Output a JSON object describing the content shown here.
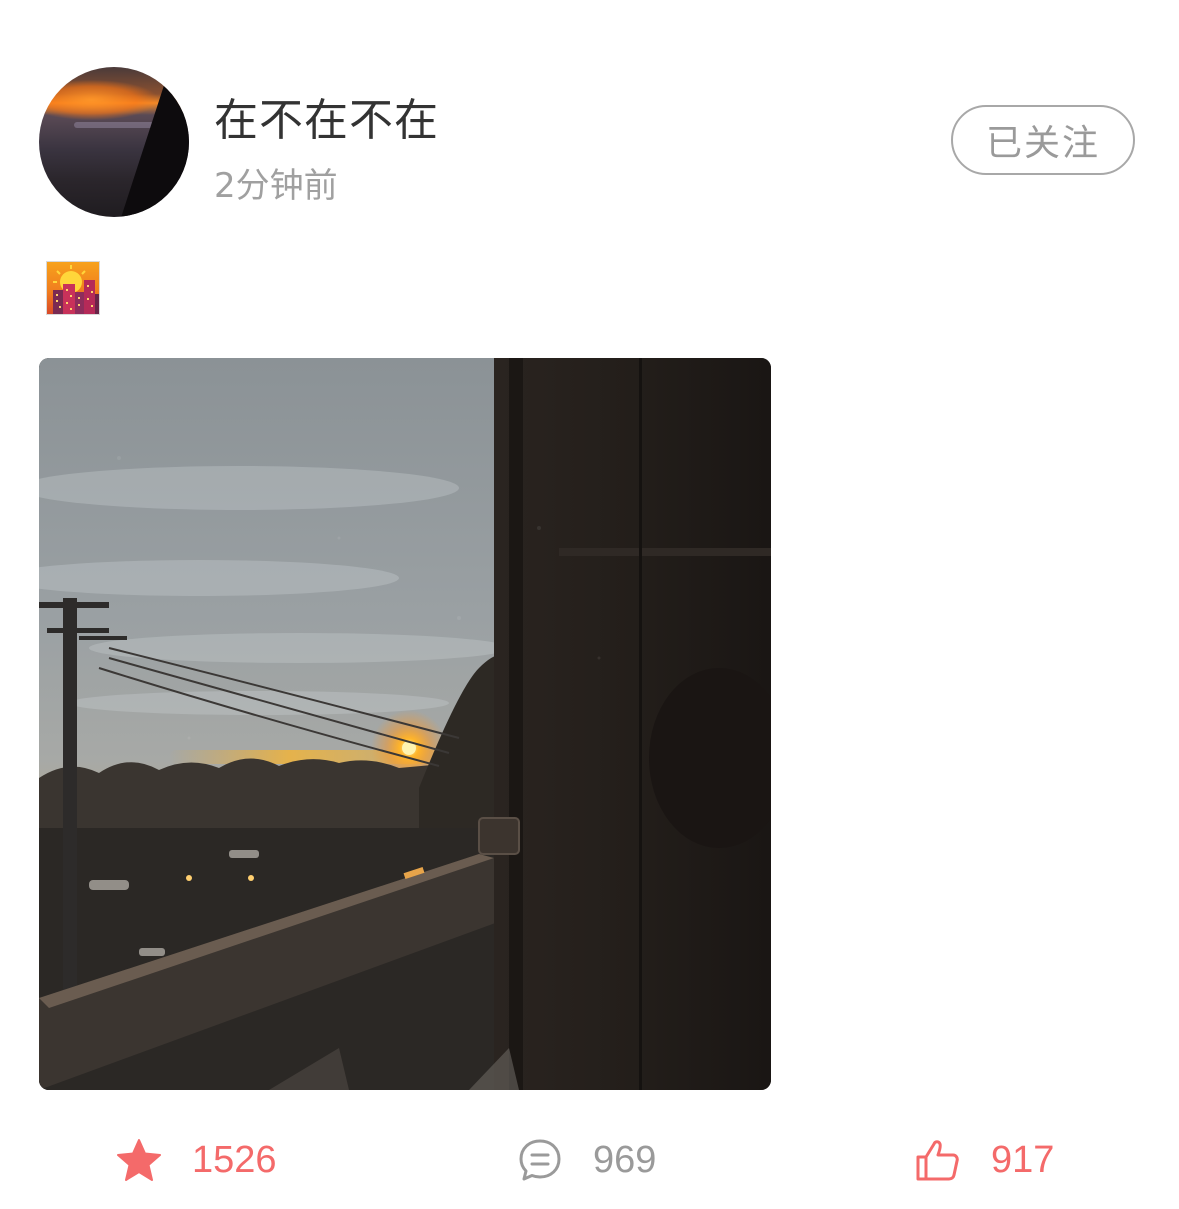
{
  "post": {
    "author": {
      "name": "在不在不在",
      "time": "2分钟前",
      "follow_label": "已关注"
    },
    "content_emoji": "city-sunset-emoji",
    "image_alt": "sunset through window photo",
    "actions": {
      "favorite_count": "1526",
      "comment_count": "969",
      "like_count": "917"
    }
  },
  "colors": {
    "accent": "#f46a6a",
    "muted": "#9a9a9a",
    "title": "#333333"
  },
  "icons": {
    "favorite": "star-icon",
    "comment": "comment-icon",
    "like": "thumbs-up-icon"
  }
}
